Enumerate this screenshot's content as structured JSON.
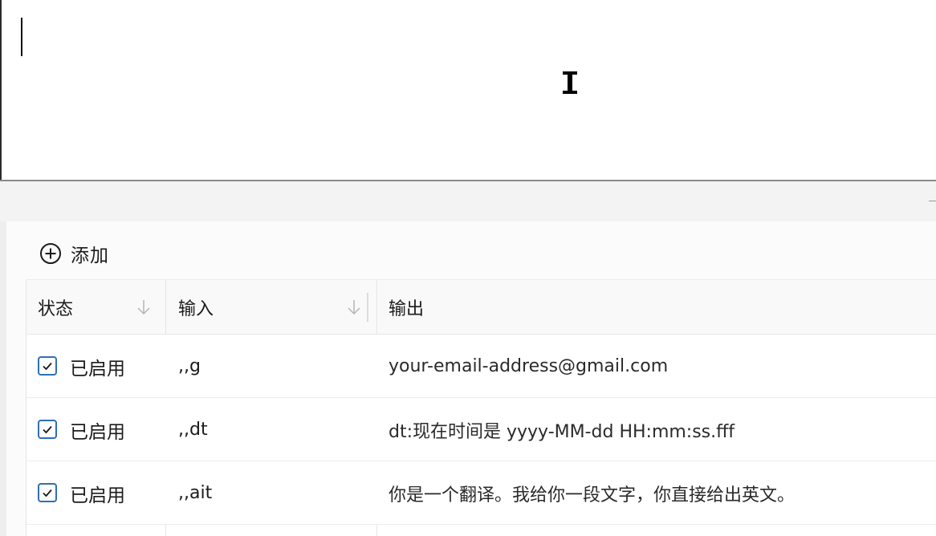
{
  "toolbar": {
    "add_label": "添加",
    "add_icon": "plus-circle-icon"
  },
  "table": {
    "columns": {
      "status": "状态",
      "input": "输入",
      "output": "输出"
    },
    "rows": [
      {
        "enabled": true,
        "status": "已启用",
        "input": ",,g",
        "output": "your-email-address@gmail.com"
      },
      {
        "enabled": true,
        "status": "已启用",
        "input": ",,dt",
        "output": "dt:现在时间是 yyyy-MM-dd HH:mm:ss.fff"
      },
      {
        "enabled": true,
        "status": "已启用",
        "input": ",,ait",
        "output": "你是一个翻译。我给你一段文字，你直接给出英文。"
      }
    ]
  },
  "colors": {
    "checkbox_border": "#2f6fb5",
    "header_bg": "#f9f9f9",
    "panel_strip_bg": "#f3f3f3"
  }
}
